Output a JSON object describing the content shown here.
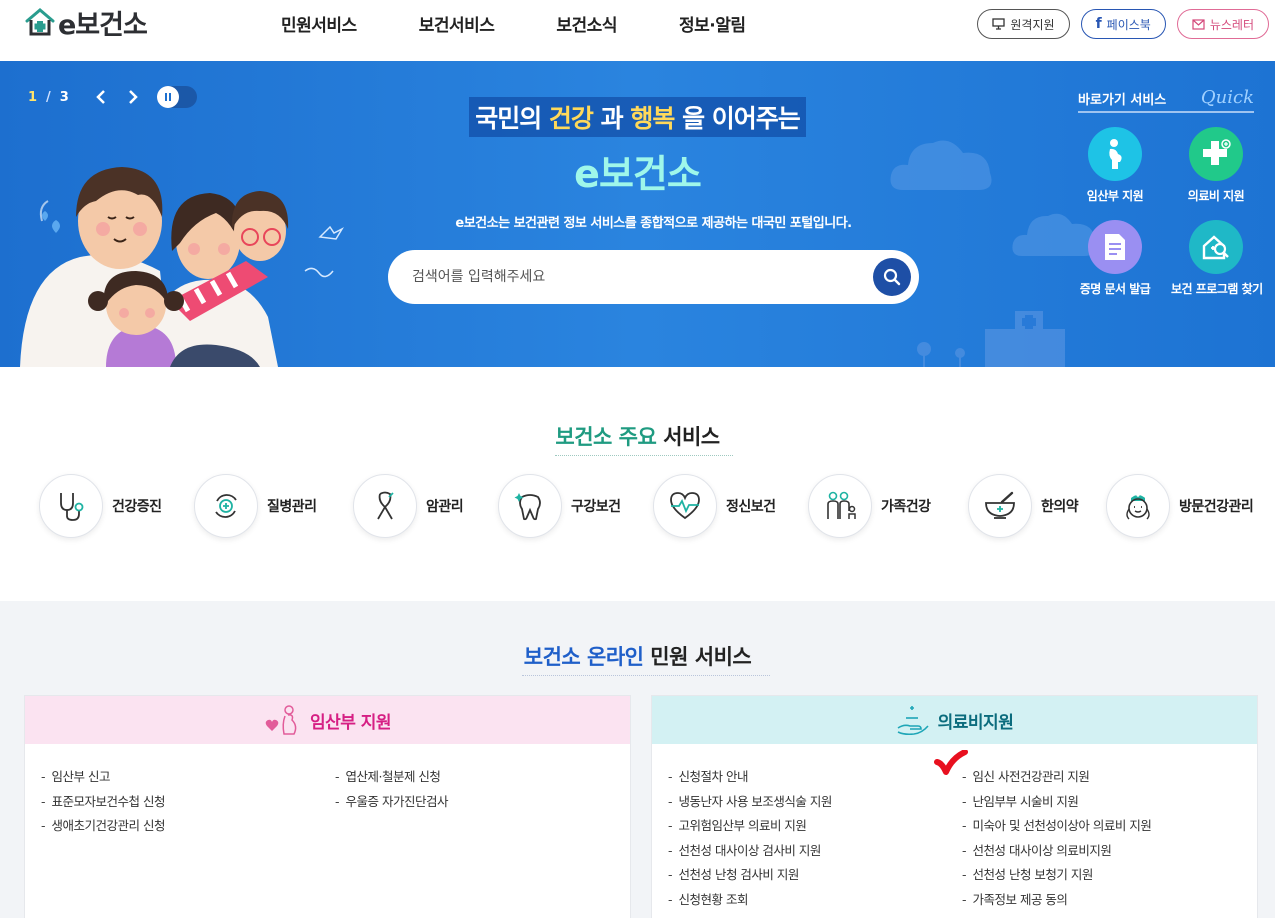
{
  "header": {
    "logo_text": "e보건소",
    "nav": [
      "민원서비스",
      "보건서비스",
      "보건소식",
      "정보·알림"
    ],
    "util": [
      {
        "label": "원격지원",
        "icon": "monitor-icon"
      },
      {
        "label": "페이스북",
        "icon": "facebook-icon"
      },
      {
        "label": "뉴스레터",
        "icon": "newsletter-icon"
      }
    ]
  },
  "hero": {
    "pager_current": "1",
    "pager_sep": "/",
    "pager_total": "3",
    "title_a": "국민의 ",
    "title_b": "건강",
    "title_c": " 과 ",
    "title_d": "행복",
    "title_e": " 을 이어주는",
    "title_line2": "e보건소",
    "desc": "e보건소는 보건관련 정보 서비스를 종합적으로 제공하는 대국민 포털입니다.",
    "search_placeholder": "검색어를 입력해주세요",
    "quick_title": "바로가기 서비스",
    "quick_script": "Quick",
    "quick_items": [
      {
        "label": "임산부 지원",
        "color": "#1ec3e6",
        "icon": "pregnant-icon"
      },
      {
        "label": "의료비 지원",
        "color": "#21c98a",
        "icon": "medical-cross-icon"
      },
      {
        "label": "증명 문서 발급",
        "color": "#9a8ff2",
        "icon": "document-icon"
      },
      {
        "label": "보건 프로그램 찾기",
        "color": "#1fb8c7",
        "icon": "program-search-icon"
      }
    ]
  },
  "main_services": {
    "title_a": "보건소 주요",
    "title_b": " 서비스",
    "items": [
      {
        "label": "건강증진",
        "icon": "stethoscope-icon"
      },
      {
        "label": "질병관리",
        "icon": "disease-cycle-icon"
      },
      {
        "label": "암관리",
        "icon": "ribbon-icon"
      },
      {
        "label": "구강보건",
        "icon": "tooth-icon"
      },
      {
        "label": "정신보건",
        "icon": "heart-pulse-icon"
      },
      {
        "label": "가족건강",
        "icon": "family-icon"
      },
      {
        "label": "한의약",
        "icon": "mortar-icon"
      },
      {
        "label": "방문건강관리",
        "icon": "nurse-icon"
      }
    ]
  },
  "online": {
    "title_a": "보건소 온라인",
    "title_b": " 민원 서비스",
    "cards": [
      {
        "title": "임산부 지원",
        "col1": [
          "임산부 신고",
          "표준모자보건수첩 신청",
          "생애초기건강관리 신청"
        ],
        "col2": [
          "엽산제·철분제 신청",
          "우울증 자가진단검사"
        ]
      },
      {
        "title": "의료비지원",
        "col1": [
          "신청절차 안내",
          "냉동난자 사용 보조생식술 지원",
          "고위험임산부 의료비 지원",
          "선천성 대사이상 검사비 지원",
          "선천성 난청 검사비 지원",
          "신청현황 조회"
        ],
        "col2": [
          "임신 사전건강관리 지원",
          "난임부부 시술비 지원",
          "미숙아 및 선천성이상아 의료비 지원",
          "선천성 대사이상 의료비지원",
          "선천성 난청 보청기 지원",
          "가족정보 제공 동의"
        ]
      }
    ]
  },
  "colors": {
    "hero_bg": "#1d6fcf",
    "accent_green": "#1f9b81",
    "accent_blue": "#1f5fc9",
    "pink": "#d61f84",
    "teal": "#0b6c7d",
    "check": "#e8101f"
  }
}
